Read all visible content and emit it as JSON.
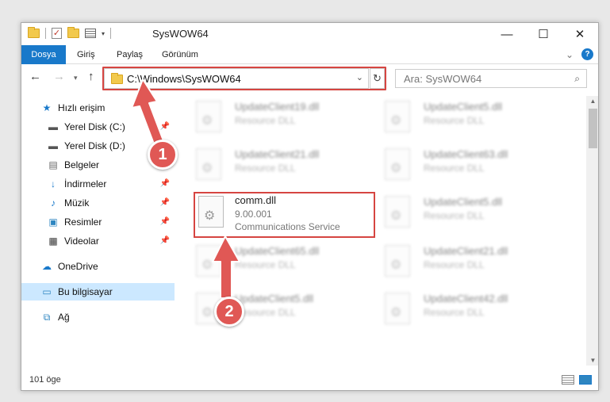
{
  "window": {
    "title": "SysWOW64"
  },
  "ribbon": {
    "tabs": [
      "Dosya",
      "Giriş",
      "Paylaş",
      "Görünüm"
    ],
    "help_label": "?"
  },
  "address": {
    "path": "C:\\Windows\\SysWOW64"
  },
  "search": {
    "placeholder": "Ara: SysWOW64"
  },
  "sidebar": {
    "items": [
      {
        "label": "Hızlı erişim",
        "icon": "star-icon"
      },
      {
        "label": "Yerel Disk (C:)",
        "icon": "drive-icon",
        "pinned": true
      },
      {
        "label": "Yerel Disk (D:)",
        "icon": "drive-icon"
      },
      {
        "label": "Belgeler",
        "icon": "document-icon"
      },
      {
        "label": "İndirmeler",
        "icon": "download-icon",
        "pinned": true
      },
      {
        "label": "Müzik",
        "icon": "music-icon",
        "pinned": true
      },
      {
        "label": "Resimler",
        "icon": "picture-icon",
        "pinned": true
      },
      {
        "label": "Videolar",
        "icon": "video-icon",
        "pinned": true
      },
      {
        "label": "OneDrive",
        "icon": "cloud-icon"
      },
      {
        "label": "Bu bilgisayar",
        "icon": "computer-icon",
        "selected": true
      },
      {
        "label": "Ağ",
        "icon": "network-icon"
      }
    ]
  },
  "files": {
    "highlighted": {
      "name": "comm.dll",
      "version": "9.00.001",
      "description": "Communications Service"
    },
    "left_column": [
      {
        "name": "UpdateClient19.dll",
        "type": "Resource DLL"
      },
      {
        "name": "UpdateClient21.dll",
        "type": "Resource DLL"
      },
      {
        "name": "UpdateClient65.dll",
        "type": "Resource DLL"
      },
      {
        "name": "UpdateClient5.dll",
        "type": "Resource DLL"
      }
    ],
    "right_column": [
      {
        "name": "UpdateClient5.dll",
        "type": "Resource DLL"
      },
      {
        "name": "UpdateClient63.dll",
        "type": "Resource DLL"
      },
      {
        "name": "UpdateClient5.dll",
        "type": "Resource DLL"
      },
      {
        "name": "UpdateClient21.dll",
        "type": "Resource DLL"
      },
      {
        "name": "UpdateClient42.dll",
        "type": "Resource DLL"
      }
    ]
  },
  "status": {
    "item_count": "101 öge"
  },
  "annotations": {
    "badge1": "1",
    "badge2": "2",
    "color": "#e05855"
  }
}
